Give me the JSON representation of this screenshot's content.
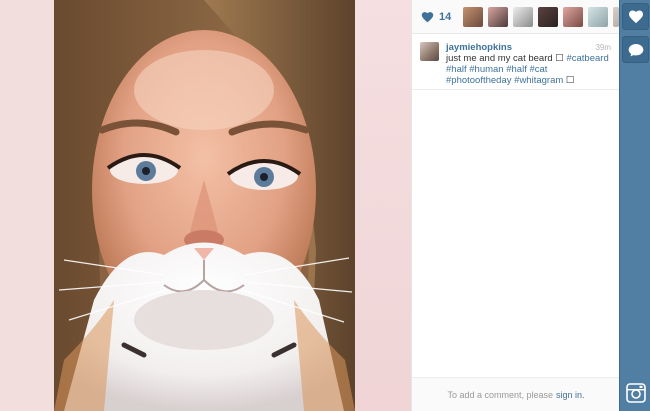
{
  "likes": {
    "count": "14",
    "icon": "heart-icon",
    "color": "#3f729b",
    "likers": [
      {
        "name": "liker-1",
        "color": "#6b4a3e"
      },
      {
        "name": "liker-2",
        "color": "#4b3a3a"
      },
      {
        "name": "liker-3",
        "color": "#8a8a8a"
      },
      {
        "name": "liker-4",
        "color": "#2b2220"
      },
      {
        "name": "liker-5",
        "color": "#7a4a44"
      },
      {
        "name": "liker-6",
        "color": "#8fa4a8"
      },
      {
        "name": "liker-7",
        "color": "#b8b0a8"
      }
    ]
  },
  "caption": {
    "username": "jaymiehopkins",
    "timestamp": "39m",
    "text_prefix": "just me and my cat beard ☐ ",
    "hashtags": [
      "#catbeard",
      "#half",
      "#human",
      "#half",
      "#cat",
      "#photooftheday",
      "#whitagram"
    ],
    "text_suffix": " ☐"
  },
  "comment_footer": {
    "prompt": "To add a comment, please",
    "link": "sign in."
  },
  "action_bar": {
    "buttons": [
      "heart-icon",
      "comment-icon"
    ],
    "logo": "instagram-logo-icon",
    "color": "#517fa4"
  }
}
